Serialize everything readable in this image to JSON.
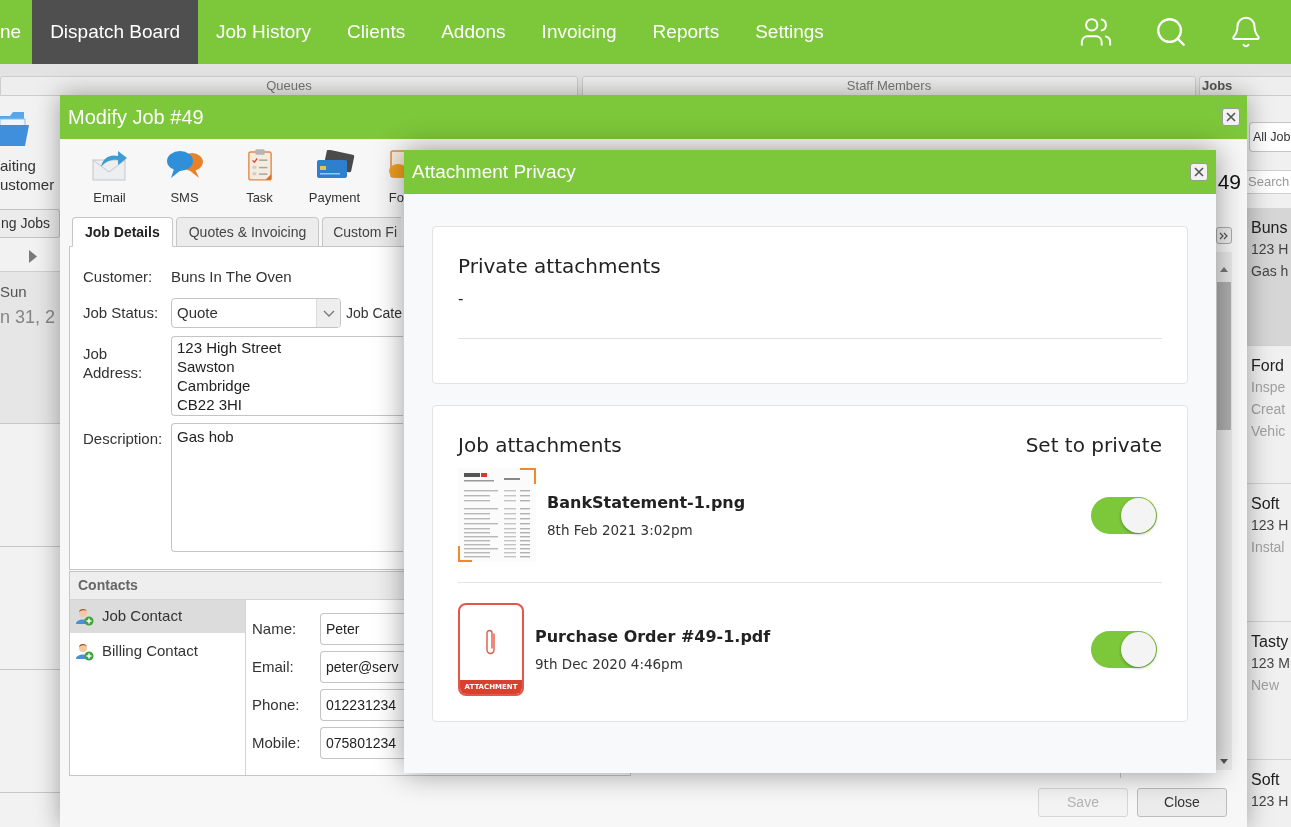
{
  "nav": {
    "items": [
      {
        "label": "ne",
        "selected": false
      },
      {
        "label": "Dispatch Board",
        "selected": true
      },
      {
        "label": "Job History",
        "selected": false
      },
      {
        "label": "Clients",
        "selected": false
      },
      {
        "label": "Addons",
        "selected": false
      },
      {
        "label": "Invoicing",
        "selected": false
      },
      {
        "label": "Reports",
        "selected": false
      },
      {
        "label": "Settings",
        "selected": false
      }
    ]
  },
  "background": {
    "panels": [
      {
        "title": "Queues"
      },
      {
        "title": "Staff Members"
      },
      {
        "title": "Jobs"
      }
    ],
    "queue": {
      "label_lines": [
        "aiting",
        "ustomer"
      ],
      "button": "ng Jobs",
      "day": "Sun",
      "date": "n 31, 2"
    },
    "jobs": {
      "filter": "All Job",
      "search_placeholder": "Search",
      "items": [
        {
          "title": "Buns",
          "selected": true,
          "lines": [
            {
              "text": "123 H",
              "muted": false
            },
            {
              "text": "Gas h",
              "muted": false
            }
          ]
        },
        {
          "title": "Ford",
          "selected": false,
          "lines": [
            {
              "text": "Inspe",
              "muted": true
            },
            {
              "text": "Creat",
              "muted": true
            },
            {
              "text": "Vehic",
              "muted": true
            }
          ]
        },
        {
          "title": "Soft",
          "selected": false,
          "lines": [
            {
              "text": "123 H",
              "muted": false
            },
            {
              "text": "Instal",
              "muted": true
            }
          ]
        },
        {
          "title": "Tasty",
          "selected": false,
          "lines": [
            {
              "text": "123 M",
              "muted": false
            },
            {
              "text": "New",
              "muted": true
            }
          ]
        },
        {
          "title": "Soft",
          "selected": false,
          "lines": [
            {
              "text": "123 H",
              "muted": false
            }
          ]
        }
      ]
    }
  },
  "modify_job": {
    "title": "Modify Job #49",
    "toolbar": [
      {
        "kind": "email",
        "label": "Email"
      },
      {
        "kind": "sms",
        "label": "SMS"
      },
      {
        "kind": "task",
        "label": "Task"
      },
      {
        "kind": "payment",
        "label": "Payment"
      },
      {
        "kind": "forms",
        "label": "Fo"
      }
    ],
    "job_number": "49",
    "tabs": [
      {
        "label": "Job Details",
        "selected": true
      },
      {
        "label": "Quotes & Invoicing",
        "selected": false
      },
      {
        "label": "Custom Fi",
        "selected": false
      }
    ],
    "form": {
      "customer": {
        "label": "Customer:",
        "value": "Buns In The Oven"
      },
      "job_status": {
        "label": "Job Status:",
        "value": "Quote"
      },
      "job_category": {
        "label": "Job Cate"
      },
      "job_address": {
        "label": "Job Address:",
        "lines": [
          "123 High Street",
          "Sawston",
          "Cambridge",
          "CB22 3HI"
        ]
      },
      "description": {
        "label": "Description:",
        "value": "Gas hob"
      }
    },
    "contacts": {
      "title": "Contacts",
      "list": [
        {
          "label": "Job Contact",
          "selected": true
        },
        {
          "label": "Billing Contact",
          "selected": false
        }
      ],
      "fields": [
        {
          "label": "Name:",
          "value": "Peter"
        },
        {
          "label": "Email:",
          "value": "peter@serv"
        },
        {
          "label": "Phone:",
          "value": "012231234"
        },
        {
          "label": "Mobile:",
          "value": "075801234"
        }
      ]
    },
    "buttons": [
      {
        "label": "Save",
        "disabled": true
      },
      {
        "label": "Close",
        "disabled": false
      }
    ]
  },
  "attachment_privacy": {
    "title": "Attachment Privacy",
    "private_section": {
      "title": "Private attachments",
      "empty_text": "-"
    },
    "job_section": {
      "title": "Job attachments",
      "column_label": "Set to private",
      "attachments": [
        {
          "kind": "image",
          "name": "BankStatement-1.png",
          "date": "8th Feb 2021 3:02pm",
          "private": true
        },
        {
          "kind": "file",
          "name": "Purchase Order #49-1.pdf",
          "date": "9th Dec 2020 4:46pm",
          "badge": "ATTACHMENT",
          "private": true
        }
      ]
    }
  }
}
